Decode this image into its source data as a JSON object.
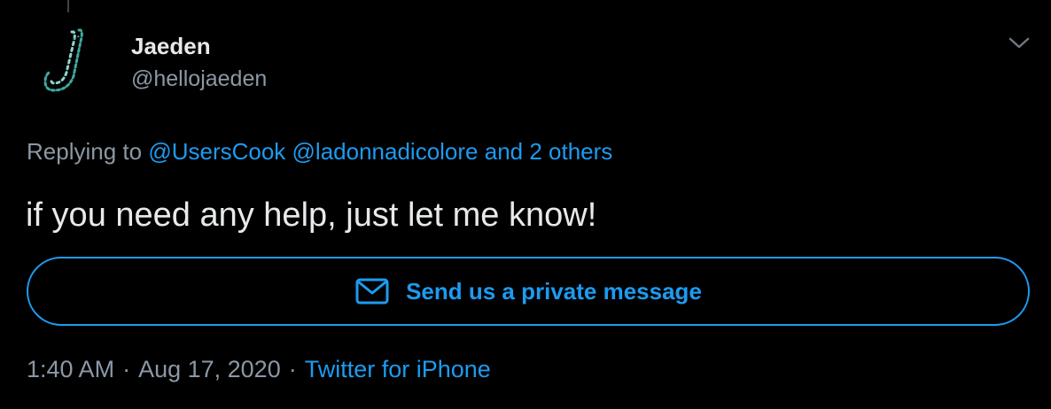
{
  "author": {
    "name": "Jaeden",
    "handle": "@hellojaeden"
  },
  "reply": {
    "prefix": "Replying to",
    "mentions": [
      "@UsersCook",
      "@ladonnadicolore"
    ],
    "others": "and 2 others"
  },
  "tweet": {
    "text": "if you need any help, just let me know!"
  },
  "dm_button": {
    "label": "Send us a private message"
  },
  "meta": {
    "time": "1:40 AM",
    "separator": "·",
    "date": "Aug 17, 2020",
    "source": "Twitter for iPhone"
  },
  "icons": {
    "avatar": "letter-j-logo",
    "menu": "chevron-down-icon",
    "dm": "envelope-icon"
  },
  "colors": {
    "background": "#000000",
    "accent": "#1d9bf0",
    "primary_text": "#e7e9ea",
    "secondary_text": "#8b98a5",
    "avatar_dash": "#3fa7a0"
  }
}
